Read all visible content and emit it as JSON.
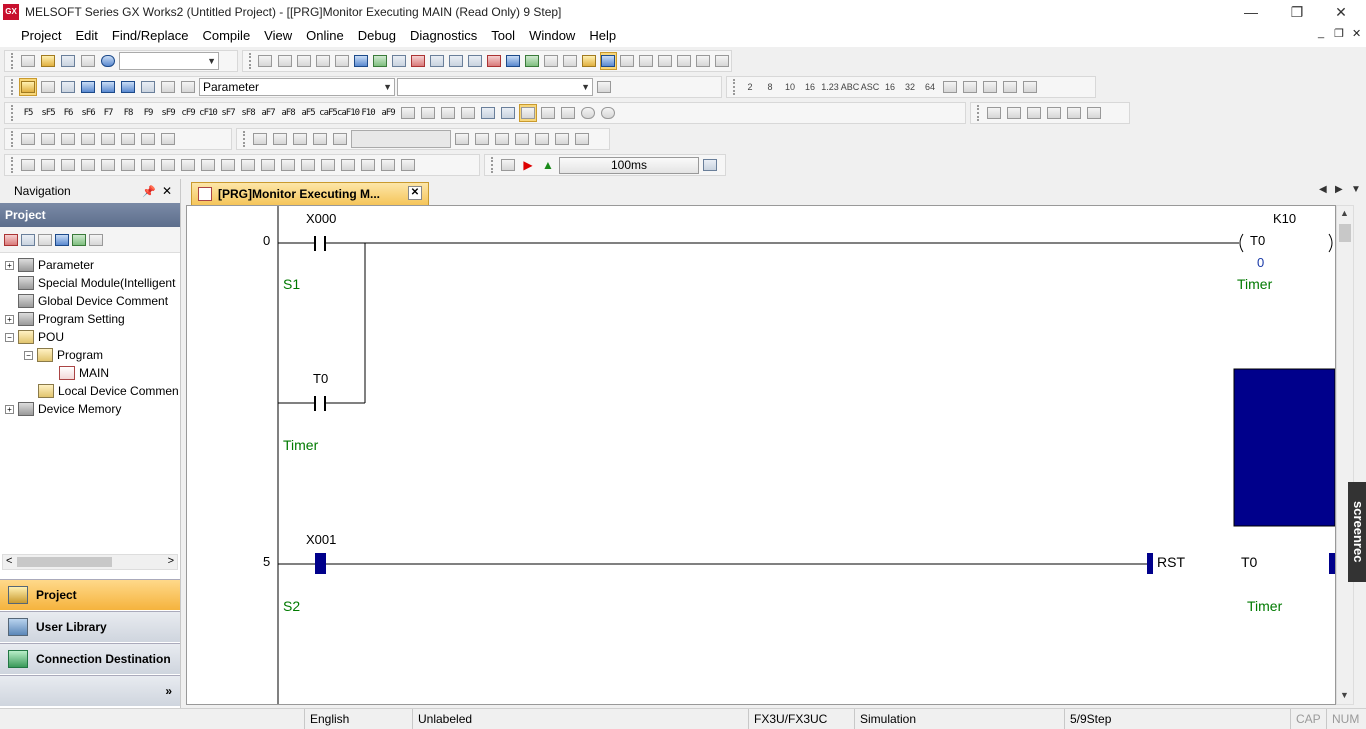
{
  "window": {
    "app_icon": "GX",
    "title": "MELSOFT Series GX Works2 (Untitled Project) - [[PRG]Monitor Executing MAIN (Read Only) 9 Step]",
    "minimize": "—",
    "restore": "❐",
    "close": "✕",
    "mdi_min": "_",
    "mdi_restore": "❐",
    "mdi_close": "✕"
  },
  "menu": [
    {
      "label": "Project"
    },
    {
      "label": "Edit"
    },
    {
      "label": "Find/Replace"
    },
    {
      "label": "Compile"
    },
    {
      "label": "View"
    },
    {
      "label": "Online"
    },
    {
      "label": "Debug"
    },
    {
      "label": "Diagnostics"
    },
    {
      "label": "Tool"
    },
    {
      "label": "Window"
    },
    {
      "label": "Help"
    }
  ],
  "toolbar": {
    "parameter_select": "Parameter",
    "timer_value": "100ms",
    "ladder_keys": [
      "F5",
      "sF5",
      "F6",
      "sF6",
      "F7",
      "F8",
      "F9",
      "sF9",
      "cF9",
      "cF10",
      "sF7",
      "sF8",
      "aF7",
      "aF8",
      "aF5",
      "caF5",
      "caF10",
      "F10",
      "aF9"
    ],
    "num_keys": [
      "2",
      "8",
      "10",
      "16",
      "1.23",
      "ABC",
      "ASC",
      "16",
      "32",
      "64"
    ]
  },
  "navigation": {
    "title": "Navigation",
    "pin": "📌",
    "close": "✕",
    "project_header": "Project",
    "tree": [
      {
        "label": "Parameter",
        "expander": "+"
      },
      {
        "label": "Special Module(Intelligent",
        "expander": ""
      },
      {
        "label": "Global Device Comment",
        "expander": ""
      },
      {
        "label": "Program Setting",
        "expander": "+"
      },
      {
        "label": "POU",
        "expander": "−"
      },
      {
        "label": "Program",
        "expander": "−"
      },
      {
        "label": "MAIN",
        "expander": ""
      },
      {
        "label": "Local Device Commen",
        "expander": ""
      },
      {
        "label": "Device Memory",
        "expander": "+"
      }
    ],
    "buttons": [
      {
        "label": "Project"
      },
      {
        "label": "User Library"
      },
      {
        "label": "Connection Destination"
      }
    ],
    "more": "»",
    "scroll_left": "<",
    "scroll_right": ">"
  },
  "tab": {
    "label": "[PRG]Monitor Executing M...",
    "close": "✕",
    "prev": "◀",
    "next": "▶",
    "menu": "▼"
  },
  "ladder": {
    "rung0": {
      "step": "0",
      "contact1_device": "X000",
      "contact1_comment": "S1",
      "contact2_device": "T0",
      "contact2_comment": "Timer",
      "coil_device": "T0",
      "coil_setting": "K10",
      "coil_value": "0",
      "coil_comment": "Timer"
    },
    "rung5": {
      "step": "5",
      "contact_device": "X001",
      "contact_comment": "S2",
      "instruction": "RST",
      "operand": "T0",
      "operand_comment": "Timer"
    }
  },
  "statusbar": {
    "language": "English",
    "label_state": "Unlabeled",
    "plc_type": "FX3U/FX3UC",
    "connection": "Simulation",
    "steps": "5/9Step",
    "cap": "CAP",
    "num": "NUM"
  },
  "overlay": {
    "watermark": "screenrec"
  },
  "colors": {
    "active_tab": "#f5c55a",
    "monitor_on": "#00008b",
    "comment_green": "#007a00"
  }
}
